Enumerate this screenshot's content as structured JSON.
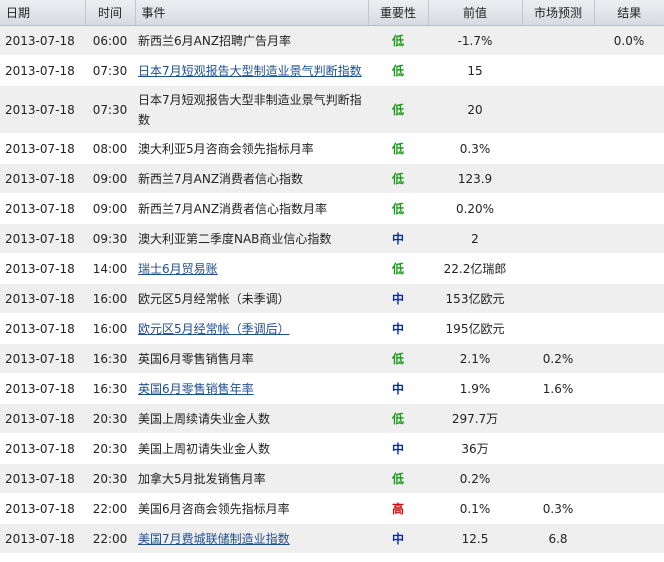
{
  "colors": {
    "low": "#1a9a1a",
    "mid": "#0b2ea8",
    "high": "#d01010",
    "link": "#1f4f8f"
  },
  "header": {
    "date": "日期",
    "time": "时间",
    "event": "事件",
    "importance": "重要性",
    "previous": "前值",
    "forecast": "市场预测",
    "actual": "结果"
  },
  "rows": [
    {
      "date": "2013-07-18",
      "time": "06:00",
      "event": "新西兰6月ANZ招聘广告月率",
      "link": false,
      "importance": "低",
      "level": "low",
      "previous": "-1.7%",
      "forecast": "",
      "actual": "0.0%"
    },
    {
      "date": "2013-07-18",
      "time": "07:30",
      "event": "日本7月短观报告大型制造业景气判断指数",
      "link": true,
      "importance": "低",
      "level": "low",
      "previous": "15",
      "forecast": "",
      "actual": ""
    },
    {
      "date": "2013-07-18",
      "time": "07:30",
      "event": "日本7月短观报告大型非制造业景气判断指数",
      "link": false,
      "importance": "低",
      "level": "low",
      "previous": "20",
      "forecast": "",
      "actual": ""
    },
    {
      "date": "2013-07-18",
      "time": "08:00",
      "event": "澳大利亚5月咨商会领先指标月率",
      "link": false,
      "importance": "低",
      "level": "low",
      "previous": "0.3%",
      "forecast": "",
      "actual": ""
    },
    {
      "date": "2013-07-18",
      "time": "09:00",
      "event": "新西兰7月ANZ消费者信心指数",
      "link": false,
      "importance": "低",
      "level": "low",
      "previous": "123.9",
      "forecast": "",
      "actual": ""
    },
    {
      "date": "2013-07-18",
      "time": "09:00",
      "event": "新西兰7月ANZ消费者信心指数月率",
      "link": false,
      "importance": "低",
      "level": "low",
      "previous": "0.20%",
      "forecast": "",
      "actual": ""
    },
    {
      "date": "2013-07-18",
      "time": "09:30",
      "event": "澳大利亚第二季度NAB商业信心指数",
      "link": false,
      "importance": "中",
      "level": "mid",
      "previous": "2",
      "forecast": "",
      "actual": ""
    },
    {
      "date": "2013-07-18",
      "time": "14:00",
      "event": "瑞士6月贸易账",
      "link": true,
      "importance": "低",
      "level": "low",
      "previous": "22.2亿瑞郎",
      "forecast": "",
      "actual": ""
    },
    {
      "date": "2013-07-18",
      "time": "16:00",
      "event": "欧元区5月经常帐（未季调）",
      "link": false,
      "importance": "中",
      "level": "mid",
      "previous": "153亿欧元",
      "forecast": "",
      "actual": ""
    },
    {
      "date": "2013-07-18",
      "time": "16:00",
      "event": "欧元区5月经常帐（季调后）",
      "link": true,
      "importance": "中",
      "level": "mid",
      "previous": "195亿欧元",
      "forecast": "",
      "actual": ""
    },
    {
      "date": "2013-07-18",
      "time": "16:30",
      "event": "英国6月零售销售月率",
      "link": false,
      "importance": "低",
      "level": "low",
      "previous": "2.1%",
      "forecast": "0.2%",
      "actual": ""
    },
    {
      "date": "2013-07-18",
      "time": "16:30",
      "event": "英国6月零售销售年率",
      "link": true,
      "importance": "中",
      "level": "mid",
      "previous": "1.9%",
      "forecast": "1.6%",
      "actual": ""
    },
    {
      "date": "2013-07-18",
      "time": "20:30",
      "event": "美国上周续请失业金人数",
      "link": false,
      "importance": "低",
      "level": "low",
      "previous": "297.7万",
      "forecast": "",
      "actual": ""
    },
    {
      "date": "2013-07-18",
      "time": "20:30",
      "event": "美国上周初请失业金人数",
      "link": false,
      "importance": "中",
      "level": "mid",
      "previous": "36万",
      "forecast": "",
      "actual": ""
    },
    {
      "date": "2013-07-18",
      "time": "20:30",
      "event": "加拿大5月批发销售月率",
      "link": false,
      "importance": "低",
      "level": "low",
      "previous": "0.2%",
      "forecast": "",
      "actual": ""
    },
    {
      "date": "2013-07-18",
      "time": "22:00",
      "event": "美国6月咨商会领先指标月率",
      "link": false,
      "importance": "高",
      "level": "high",
      "previous": "0.1%",
      "forecast": "0.3%",
      "actual": ""
    },
    {
      "date": "2013-07-18",
      "time": "22:00",
      "event": "美国7月费城联储制造业指数",
      "link": true,
      "importance": "中",
      "level": "mid",
      "previous": "12.5",
      "forecast": "6.8",
      "actual": ""
    }
  ]
}
